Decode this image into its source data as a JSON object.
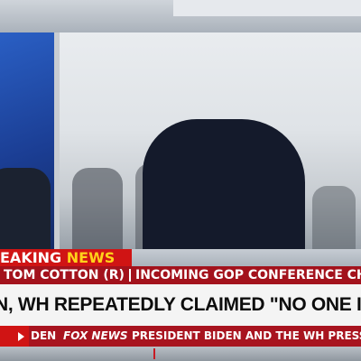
{
  "banner": {
    "word1": "EAKING",
    "word2": "NEWS"
  },
  "name_strap": {
    "name": "TOM COTTON (R)",
    "title": "INCOMING GOP CONFERENCE CHAIR"
  },
  "headline": {
    "text": "N, WH REPEATEDLY CLAIMED \"NO ONE IS ABOVE LAW\""
  },
  "ticker": {
    "prefix": "DEN",
    "logo_text": "FOX NEWS",
    "text": "PRESIDENT BIDEN AND THE WH PRESS SEC"
  },
  "colors": {
    "breaking_red": "#d01414",
    "news_yellow": "#ffd21a",
    "strap_red": "#a3121c",
    "headline_bg": "#f4f4f4"
  }
}
